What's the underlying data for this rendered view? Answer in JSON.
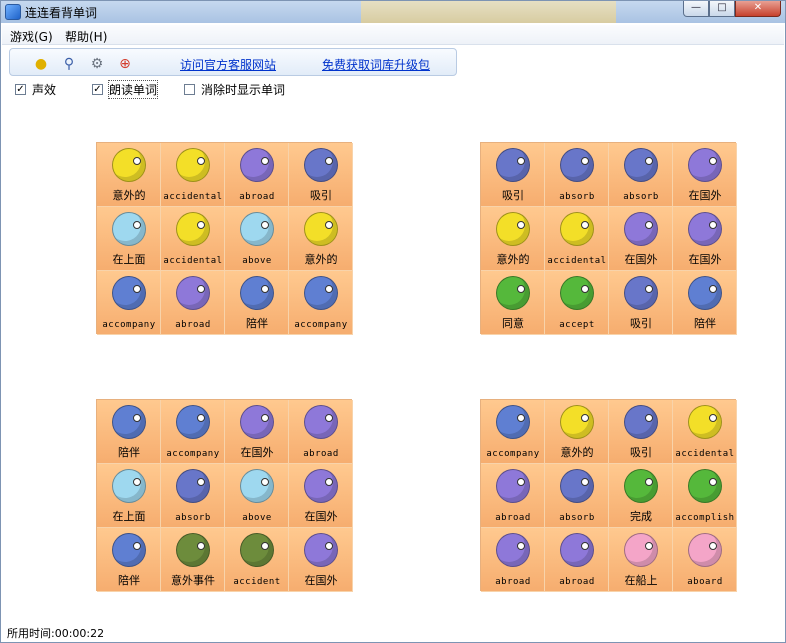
{
  "window": {
    "title": "连连看背单词",
    "min_label": "—",
    "max_label": "□",
    "close_label": "✕"
  },
  "menu": [
    {
      "label": "游戏(G)"
    },
    {
      "label": "帮助(H)"
    }
  ],
  "toolbar": {
    "links": [
      "访问官方客服网站",
      "免费获取词库升级包"
    ]
  },
  "options": [
    {
      "label": "声效",
      "checked": true
    },
    {
      "label": "朗读单词",
      "checked": true
    },
    {
      "label": "消除时显示单词",
      "checked": false
    }
  ],
  "boards": [
    {
      "tiles": [
        {
          "label": "意外的",
          "c": "yellow"
        },
        {
          "label": "accidental",
          "c": "yellow"
        },
        {
          "label": "abroad",
          "c": "purple"
        },
        {
          "label": "吸引",
          "c": "whale"
        },
        {
          "label": "在上面",
          "c": "bubble"
        },
        {
          "label": "accidental",
          "c": "yellow"
        },
        {
          "label": "above",
          "c": "bubble"
        },
        {
          "label": "意外的",
          "c": "yellow"
        },
        {
          "label": "accompany",
          "c": "blue"
        },
        {
          "label": "abroad",
          "c": "purple"
        },
        {
          "label": "陪伴",
          "c": "blue"
        },
        {
          "label": "accompany",
          "c": "blue"
        }
      ]
    },
    {
      "tiles": [
        {
          "label": "吸引",
          "c": "whale"
        },
        {
          "label": "absorb",
          "c": "whale"
        },
        {
          "label": "absorb",
          "c": "whale"
        },
        {
          "label": "在国外",
          "c": "purple"
        },
        {
          "label": "意外的",
          "c": "yellow"
        },
        {
          "label": "accidental",
          "c": "yellow"
        },
        {
          "label": "在国外",
          "c": "purple"
        },
        {
          "label": "在国外",
          "c": "purple"
        },
        {
          "label": "同意",
          "c": "green"
        },
        {
          "label": "accept",
          "c": "green"
        },
        {
          "label": "吸引",
          "c": "whale"
        },
        {
          "label": "陪伴",
          "c": "blue"
        }
      ]
    },
    {
      "tiles": [
        {
          "label": "陪伴",
          "c": "blue"
        },
        {
          "label": "accompany",
          "c": "blue"
        },
        {
          "label": "在国外",
          "c": "purple"
        },
        {
          "label": "abroad",
          "c": "purple"
        },
        {
          "label": "在上面",
          "c": "bubble"
        },
        {
          "label": "absorb",
          "c": "whale"
        },
        {
          "label": "above",
          "c": "bubble"
        },
        {
          "label": "在国外",
          "c": "purple"
        },
        {
          "label": "陪伴",
          "c": "blue"
        },
        {
          "label": "意外事件",
          "c": "snail"
        },
        {
          "label": "accident",
          "c": "snail"
        },
        {
          "label": "在国外",
          "c": "purple"
        }
      ]
    },
    {
      "tiles": [
        {
          "label": "accompany",
          "c": "blue"
        },
        {
          "label": "意外的",
          "c": "yellow"
        },
        {
          "label": "吸引",
          "c": "whale"
        },
        {
          "label": "accidental",
          "c": "yellow"
        },
        {
          "label": "abroad",
          "c": "purple"
        },
        {
          "label": "absorb",
          "c": "whale"
        },
        {
          "label": "完成",
          "c": "green"
        },
        {
          "label": "accomplish",
          "c": "green"
        },
        {
          "label": "abroad",
          "c": "purple"
        },
        {
          "label": "abroad",
          "c": "purple"
        },
        {
          "label": "在船上",
          "c": "pink"
        },
        {
          "label": "aboard",
          "c": "pink"
        }
      ]
    }
  ],
  "status": {
    "label": "所用时间:",
    "time": "00:00:22"
  }
}
